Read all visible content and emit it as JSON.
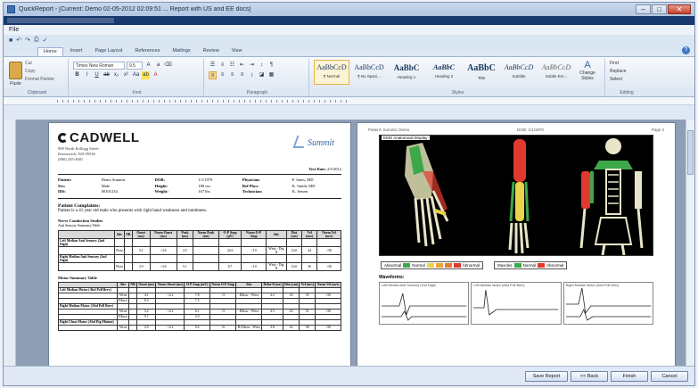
{
  "window": {
    "title": "QuickReport - [Current: Demo 02-05-2012 02:09:51 ... Report with US and EE docs]"
  },
  "window_controls": {
    "minimize": "–",
    "maximize": "□",
    "close": "✕"
  },
  "menubar": {
    "label": "File"
  },
  "ribbon": {
    "tabs": [
      "Home",
      "Insert",
      "Page Layout",
      "References",
      "Mailings",
      "Review",
      "View"
    ],
    "help_label": "?",
    "clipboard": {
      "paste": "Paste",
      "cut": "Cut",
      "copy": "Copy",
      "format_painter": "Format Painter",
      "group": "Clipboard"
    },
    "font": {
      "family": "Times New Roman",
      "size": "9.5",
      "group": "Font"
    },
    "paragraph": {
      "group": "Paragraph"
    },
    "styles": {
      "items": [
        {
          "sample": "AaBbCcD",
          "name": "¶ Normal"
        },
        {
          "sample": "AaBbCcD",
          "name": "¶ No Spaci..."
        },
        {
          "sample": "AaBbC",
          "name": "Heading 1"
        },
        {
          "sample": "AaBbC",
          "name": "Heading 2"
        },
        {
          "sample": "AaBbC",
          "name": "Title"
        },
        {
          "sample": "AaBbCcD",
          "name": "Subtitle"
        },
        {
          "sample": "AaBbCcD",
          "name": "Subtle Em..."
        }
      ],
      "change_styles": "Change Styles",
      "group": "Styles"
    },
    "editing": {
      "find": "Find",
      "replace": "Replace",
      "select": "Select",
      "group": "Editing"
    }
  },
  "report": {
    "company": "CADWELL",
    "address": [
      "909 North Kellogg Street",
      "Kennewick, WA 99336",
      "(800) 245-3001"
    ],
    "product": "Summit",
    "test_date_label": "Test Date:",
    "test_date": "2/5/2012",
    "patient": [
      {
        "k": "Patient:",
        "v": "Demo Summit"
      },
      {
        "k": "DOB:",
        "v": "1/1/1970"
      },
      {
        "k": "Physician:",
        "v": "P. Jones, MD"
      },
      {
        "k": "Sex:",
        "v": "Male"
      },
      {
        "k": "Height:",
        "v": "180 cm"
      },
      {
        "k": "Ref Phys:",
        "v": "K. Smith, MD"
      },
      {
        "k": "ID#:",
        "v": "00101234"
      },
      {
        "k": "Weight:",
        "v": "167 lbs"
      },
      {
        "k": "Technician:",
        "v": "K. Jensen"
      }
    ],
    "complaint_title": "Patient Complaints:",
    "complaint_text": "Patient is a 41 year old male who presents with right hand weakness and numbness.",
    "nerve_section": "Nerve Conduction Studies",
    "nerve_sub": "Anti Sensory Summary Table",
    "nerve_headers": [
      "Site",
      "NR",
      "Onset (ms)",
      "Norm Onset (ms)",
      "Peak (ms)",
      "Norm Peak (ms)",
      "O-P Amp (µV)",
      "Norm O-P Amp",
      "Site",
      "Dist (cm)",
      "Vel (m/s)",
      "Norm Vel (m/s)"
    ],
    "nerve_rows": [
      {
        "name": "Left Median Anti Sensory (2nd Digit)",
        "cells": [
          "",
          "",
          "",
          "",
          "",
          "",
          "",
          "",
          "",
          "",
          "",
          ""
        ]
      },
      {
        "name": "",
        "cells": [
          "Wrist",
          "",
          "3.2",
          "<3.6",
          "4.5",
          "",
          "24.6",
          ">10",
          "Wrist - Dig II",
          "14.0",
          "44",
          ">50"
        ]
      },
      {
        "name": "Right Median Anti Sensory (2nd Digit)",
        "cells": [
          "",
          "",
          "",
          "",
          "",
          "",
          "",
          "",
          "",
          "",
          "",
          ""
        ]
      },
      {
        "name": "",
        "cells": [
          "Wrist",
          "",
          "3.9",
          "<3.6",
          "5.1",
          "",
          "8.7",
          ">10",
          "Wrist - Dig II",
          "14.0",
          "36",
          ">50"
        ]
      }
    ],
    "motor_section": "Motor Summary Table",
    "motor_headers": [
      "Site",
      "NR",
      "Onset (ms)",
      "Norm Onset (ms)",
      "O-P Amp (mV)",
      "Norm O-P Amp",
      "Site",
      "Delta-0 (ms)",
      "Dist (cm)",
      "Vel (m/s)",
      "Norm Vel (m/s)"
    ],
    "motor_rows": [
      {
        "name": "Left Median Motor (Abd Poll Brev)",
        "cells": [
          "",
          "",
          "",
          "",
          "",
          "",
          "",
          "",
          "",
          "",
          ""
        ]
      },
      {
        "name": "",
        "cells": [
          "Wrist",
          "",
          "4.1",
          "<4.2",
          "7.8",
          ">5",
          "Elbow - Wrist",
          "4.2",
          "23",
          "55",
          ">50"
        ]
      },
      {
        "name": "",
        "cells": [
          "Elbow",
          "",
          "8.3",
          "",
          "7.5",
          "",
          "",
          "",
          "",
          "",
          ""
        ]
      },
      {
        "name": "Right Median Motor (Abd Poll Brev)",
        "cells": [
          "",
          "",
          "",
          "",
          "",
          "",
          "",
          "",
          "",
          "",
          ""
        ]
      },
      {
        "name": "",
        "cells": [
          "Wrist",
          "",
          "5.2",
          "<4.2",
          "6.1",
          ">5",
          "Elbow - Wrist",
          "4.5",
          "23",
          "51",
          ">50"
        ]
      },
      {
        "name": "",
        "cells": [
          "Elbow",
          "",
          "9.7",
          "",
          "5.9",
          "",
          "",
          "",
          "",
          "",
          ""
        ]
      },
      {
        "name": "Right Ulnar Motor (Abd Dig Minimi)",
        "cells": [
          "",
          "",
          "",
          "",
          "",
          "",
          "",
          "",
          "",
          "",
          ""
        ]
      },
      {
        "name": "",
        "cells": [
          "Wrist",
          "",
          "2.9",
          "<4.2",
          "9.4",
          ">6",
          "B Elbow - Wrist",
          "3.8",
          "22",
          "58",
          ">50"
        ]
      }
    ]
  },
  "page2": {
    "header_left": "Patient: Summit, Demo",
    "header_mid": "DOB: 1/1/1970",
    "header_right": "Page 2",
    "anatomy_label": "EMG Anatomical Display",
    "legend_muscles": "Muscles",
    "legend_abnormal": "Abnormal",
    "legend_normal": "Normal",
    "legend_items": [
      "Normal",
      "",
      "",
      "",
      "Abnormal"
    ],
    "waveforms_title": "Waveforms:",
    "wave_labels": [
      "Left Median Anti Sensory (2nd Digit)",
      "Left Median Motor (Abd Poll Brev)",
      "Right Median Motor (Abd Poll Brev)"
    ]
  },
  "colors": {
    "muscle_normal": "#3da84a",
    "muscle_abnormal": "#e03a2f",
    "muscle_mild": "#e8d34a",
    "legend_scale": [
      "#3da84a",
      "#e8d34a",
      "#eba437",
      "#e57a33",
      "#e03a2f"
    ]
  },
  "buttons": {
    "save_report": "Save Report",
    "back": "<< Back",
    "finish": "Finish",
    "cancel": "Cancel"
  }
}
